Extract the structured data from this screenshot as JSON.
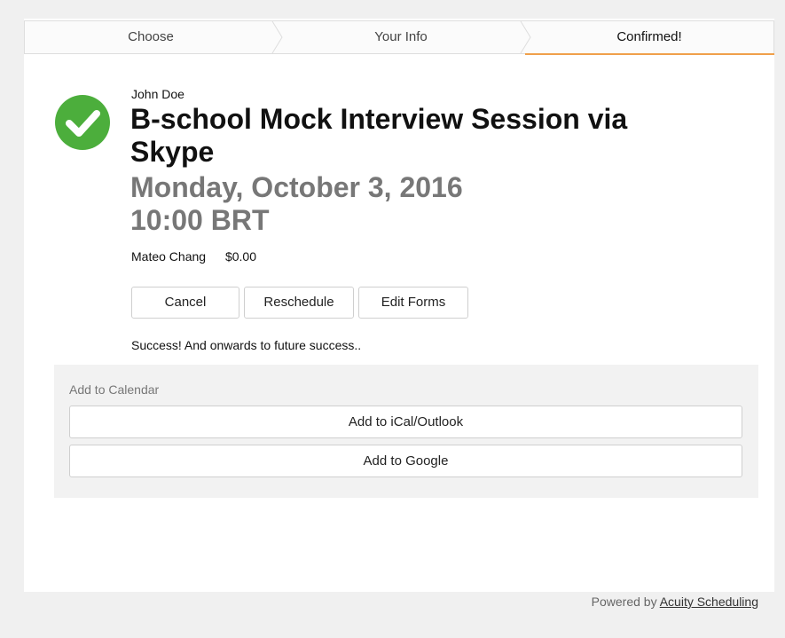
{
  "steps": {
    "items": [
      {
        "label": "Choose"
      },
      {
        "label": "Your Info"
      },
      {
        "label": "Confirmed!"
      }
    ],
    "active_index": 2,
    "active_color": "#f0a04b"
  },
  "confirmation": {
    "status_icon": "checkmark-circle-icon",
    "status_color": "#4cae3c",
    "client_name": "John Doe",
    "appointment_title": "B-school Mock Interview Session via Skype",
    "date": "Monday, October 3, 2016",
    "time": "10:00 BRT",
    "calendar_name": "Mateo Chang",
    "price": "$0.00",
    "actions": {
      "cancel": "Cancel",
      "reschedule": "Reschedule",
      "edit_forms": "Edit Forms"
    },
    "message": "Success! And onwards to future success.."
  },
  "add_to_calendar": {
    "label": "Add to Calendar",
    "ical": "Add to iCal/Outlook",
    "google": "Add to Google"
  },
  "footer": {
    "prefix": "Powered by",
    "link": "Acuity Scheduling"
  }
}
